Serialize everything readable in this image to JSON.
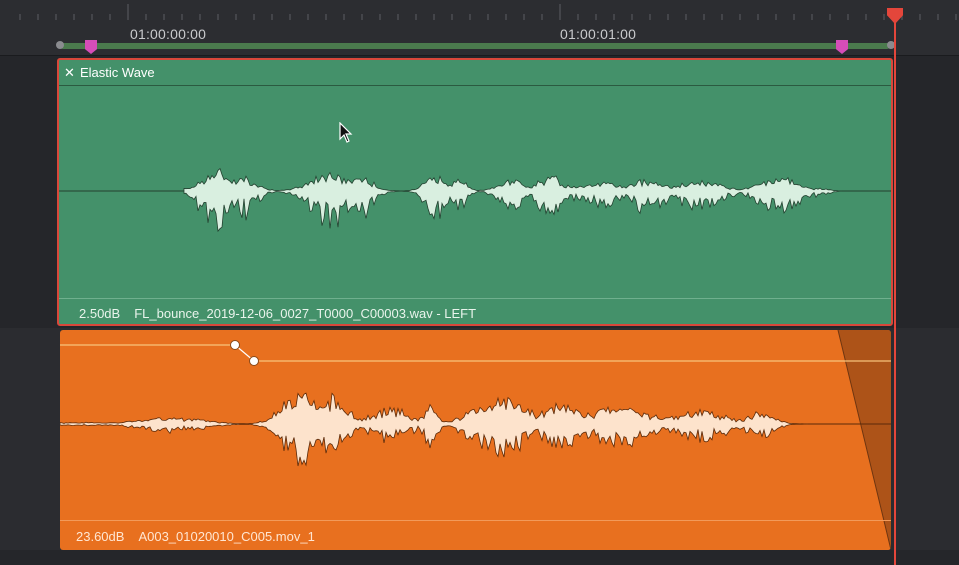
{
  "timeline": {
    "timecodes": [
      "01:00:00:00",
      "01:00:01:00"
    ]
  },
  "track_1": {
    "clip": {
      "effect_title": "Elastic Wave",
      "gain": "2.50dB",
      "filename": "FL_bounce_2019-12-06_0027_T0000_C00003.wav - LEFT"
    }
  },
  "track_2": {
    "clip": {
      "gain": "23.60dB",
      "filename": "A003_01020010_C005.mov_1"
    }
  },
  "colors": {
    "clip_green": "#44916a",
    "clip_orange": "#e8701f",
    "playhead": "#e4463b",
    "marker": "#d64db8",
    "selection_border": "#d9473a"
  },
  "icons": {
    "close": "close-icon",
    "marker": "marker-icon",
    "playhead": "playhead-icon",
    "cursor": "cursor-icon"
  }
}
